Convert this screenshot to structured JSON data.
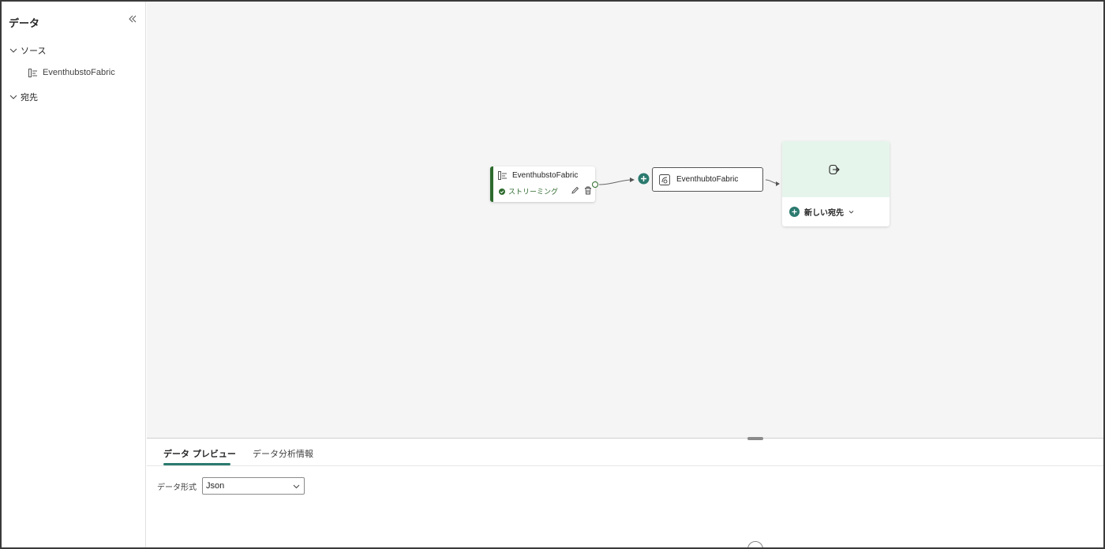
{
  "sidebar": {
    "title": "データ",
    "collapse_icon": "double-chevron-left-icon",
    "groups": [
      {
        "label": "ソース",
        "items": [
          {
            "label": "EventhubstoFabric",
            "icon": "event-hub-icon"
          }
        ]
      },
      {
        "label": "宛先",
        "items": []
      }
    ]
  },
  "canvas": {
    "source_node": {
      "title": "EventhubstoFabric",
      "status": "ストリーミング",
      "icon": "event-hub-icon"
    },
    "stream_node": {
      "title": "EventhubtoFabric",
      "icon": "eventstream-icon"
    },
    "destination_node": {
      "add_label": "新しい宛先",
      "icon": "export-icon"
    }
  },
  "bottom_panel": {
    "tabs": [
      {
        "label": "データ プレビュー",
        "active": true
      },
      {
        "label": "データ分析情報",
        "active": false
      }
    ],
    "format_label": "データ形式",
    "format_value": "Json"
  },
  "colors": {
    "accent": "#2b7a6f",
    "streaming_green": "#2d6a2d",
    "dest_bg": "#e6f5ec"
  }
}
